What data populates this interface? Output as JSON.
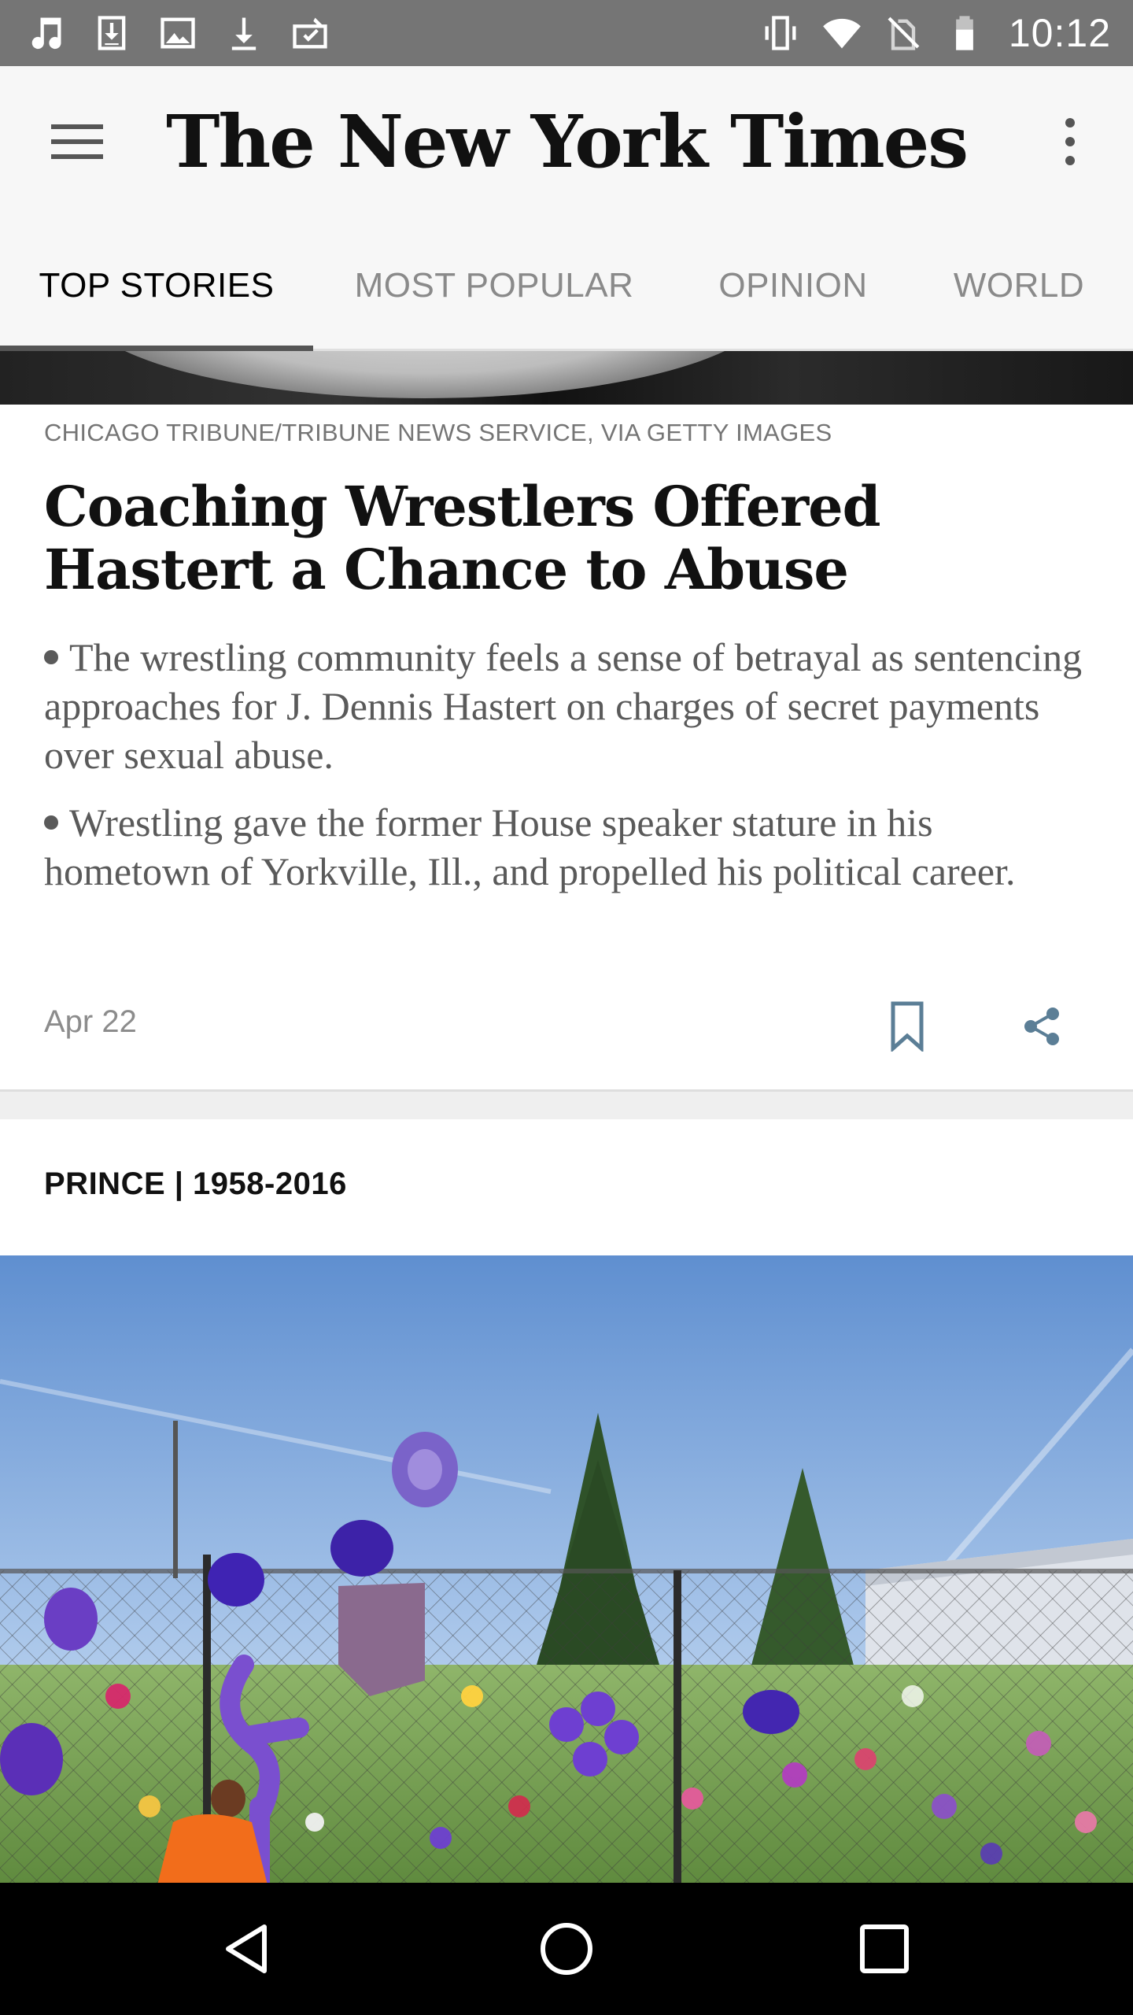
{
  "status_bar": {
    "time": "10:12",
    "left_icons": [
      "music-note-icon",
      "download-box-icon",
      "image-icon",
      "download-icon",
      "briefcase-check-icon"
    ],
    "right_icons": [
      "vibrate-icon",
      "wifi-icon",
      "no-sim-icon",
      "battery-icon"
    ]
  },
  "app_bar": {
    "logo_text": "The New York Times",
    "menu_icon": "hamburger-menu-icon",
    "more_icon": "more-vert-icon"
  },
  "tabs": [
    {
      "label": "TOP STORIES",
      "active": true
    },
    {
      "label": "MOST POPULAR",
      "active": false
    },
    {
      "label": "OPINION",
      "active": false
    },
    {
      "label": "WORLD",
      "active": false
    }
  ],
  "story1": {
    "photo_credit": "CHICAGO TRIBUNE/TRIBUNE NEWS SERVICE, VIA GETTY IMAGES",
    "headline": "Coaching Wrestlers Offered Hastert a Chance to Abuse",
    "bullets": [
      "The wrestling community feels a sense of betrayal as sentencing approaches for J. Dennis Hastert on charges of secret payments over sexual abuse.",
      "Wrestling gave the former House speaker stature in his hometown of Yorkville, Ill., and propelled his political career."
    ],
    "date": "Apr 22",
    "accent_color": "#5b7e96"
  },
  "story2": {
    "kicker": "PRINCE | 1958-2016"
  },
  "nav_bar": {
    "icons": [
      "back-icon",
      "home-icon",
      "recents-icon"
    ]
  }
}
